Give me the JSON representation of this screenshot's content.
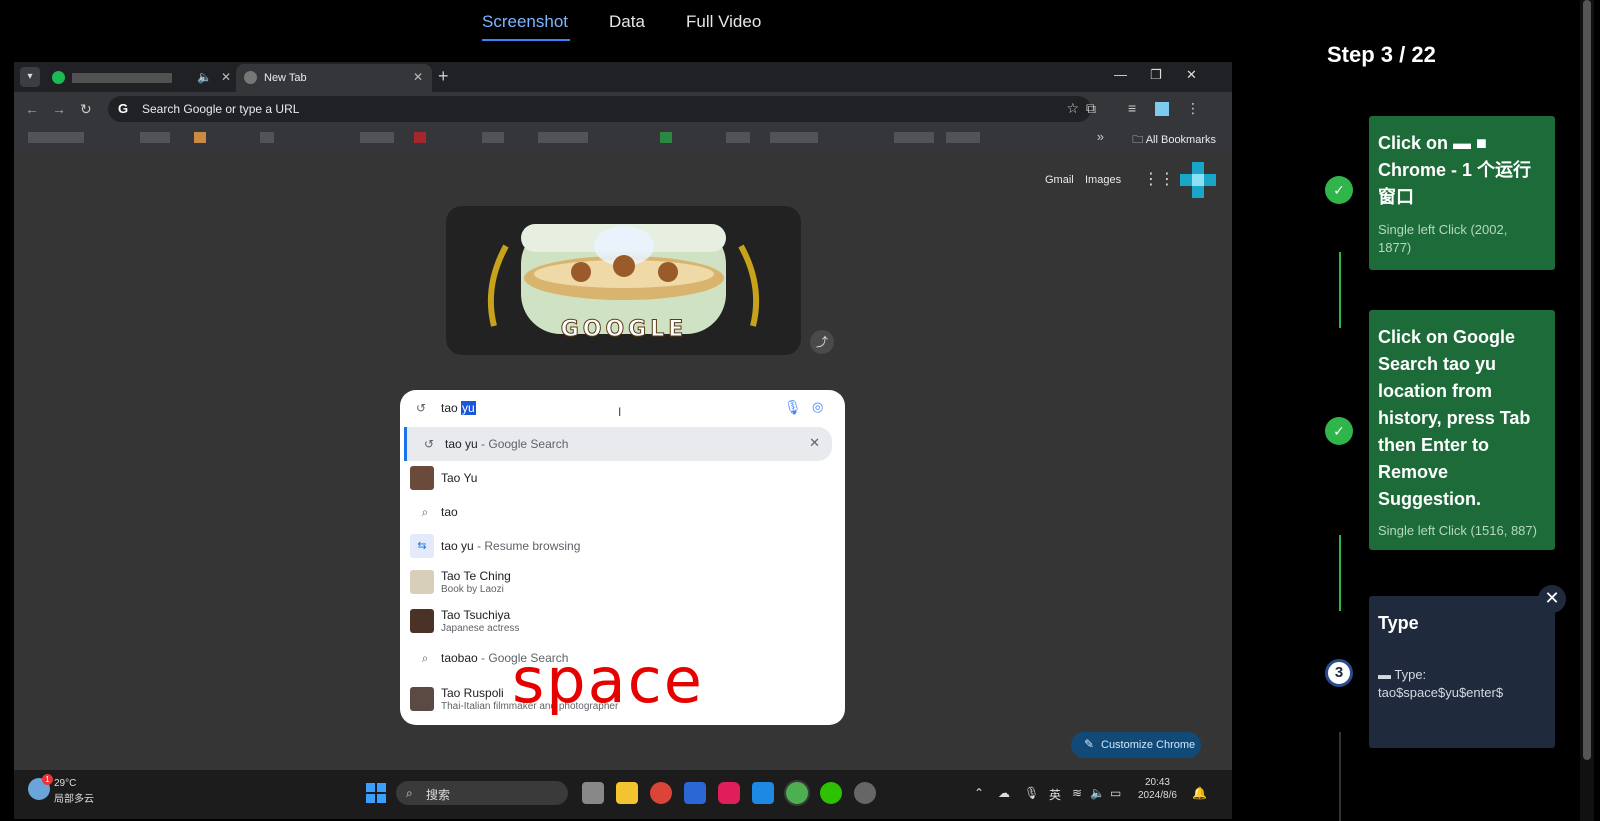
{
  "nav": {
    "tabs": [
      {
        "label": "Screenshot"
      },
      {
        "label": "Data"
      },
      {
        "label": "Full Video"
      }
    ]
  },
  "browser": {
    "tab_active_title": "New Tab",
    "omnibox_placeholder": "Search Google or type a URL",
    "bookmarks_all": "All Bookmarks",
    "ntp_links": {
      "gmail": "Gmail",
      "images": "Images"
    },
    "doodle_text": "GOOGLE",
    "search": {
      "typed_prefix": "tao ",
      "typed_selected": "yu",
      "suggestions": [
        {
          "bold": "tao yu",
          "rest": " - Google Search",
          "icon": "history-icon"
        },
        {
          "bold": "Tao Yu",
          "rest": "",
          "icon": "person-thumb"
        },
        {
          "bold": "tao",
          "rest": "",
          "icon": "search-icon"
        },
        {
          "bold": "tao yu",
          "rest": " - Resume browsing",
          "icon": "journey-icon"
        },
        {
          "bold": "Tao Te Ching",
          "sub": "Book by Laozi",
          "icon": "book-thumb"
        },
        {
          "bold": "Tao Tsuchiya",
          "sub": "Japanese actress",
          "icon": "person-thumb"
        },
        {
          "bold": "taobao",
          "rest": " - Google Search",
          "icon": "search-icon"
        },
        {
          "bold": "Tao Ruspoli",
          "sub": "Thai-Italian filmmaker and photographer",
          "icon": "person-thumb"
        }
      ]
    },
    "overlay_key": "space",
    "customize_label": "Customize Chrome"
  },
  "taskbar": {
    "weather_temp": "29°C",
    "weather_cond": "局部多云",
    "weather_badge": "1",
    "search_label": "搜索",
    "ime": "英",
    "time": "20:43",
    "date": "2024/8/6"
  },
  "steps": {
    "header": "Step 3 / 22",
    "items": [
      {
        "title_lines": [
          "Click on ▬ ■",
          "Chrome - 1 个运行",
          "窗口"
        ],
        "sub_lines": [
          "Single left Click (2002,",
          "1877)"
        ],
        "status": "done"
      },
      {
        "title_lines": [
          "Click on Google",
          "Search tao yu",
          "location from",
          "history, press Tab",
          "then Enter to",
          "Remove",
          "Suggestion."
        ],
        "sub_lines": [
          "Single left Click (1516, 887)"
        ],
        "status": "done"
      },
      {
        "title_lines": [
          "Type"
        ],
        "sub_lines": [
          "▬ Type:",
          "tao$space$yu$enter$"
        ],
        "status": "current",
        "number": "3"
      }
    ]
  },
  "colors": {
    "accent": "#3b82f6",
    "done": "#1e6b3a",
    "current": "#1f2a3c",
    "check": "#2fb54a",
    "overlay": "#e60000"
  }
}
